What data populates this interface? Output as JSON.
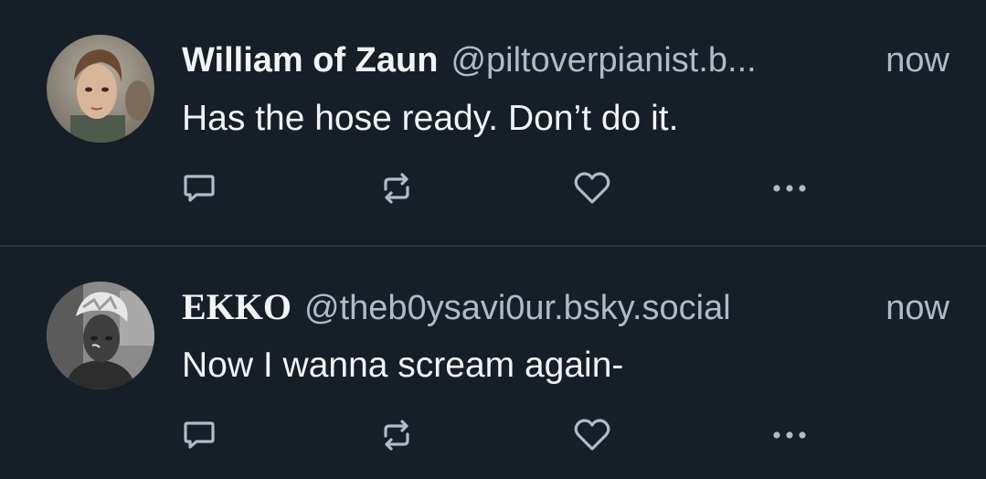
{
  "colors": {
    "background": "#161e27",
    "divider": "#2a3441",
    "primary_text": "#f1f3f5",
    "secondary_text": "#aebbc9",
    "icon": "#aebbc9"
  },
  "posts": [
    {
      "display_name": "William of Zaun",
      "handle": "@piltoverpianist.b...",
      "timestamp": "now",
      "text": "Has the hose ready. Don’t do it.",
      "avatar": "avatar-image",
      "actions": [
        "reply-icon",
        "repost-icon",
        "like-icon",
        "more-icon"
      ]
    },
    {
      "display_name": "EKKO",
      "handle": "@theb0ysavi0ur.bsky.social",
      "timestamp": "now",
      "text": "Now I wanna scream again-",
      "avatar": "avatar-image",
      "actions": [
        "reply-icon",
        "repost-icon",
        "like-icon",
        "more-icon"
      ]
    }
  ]
}
